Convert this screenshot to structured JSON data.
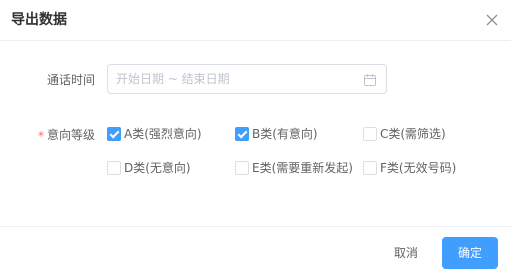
{
  "dialog": {
    "title": "导出数据",
    "close_icon": "close-icon"
  },
  "form": {
    "date_label": "通话时间",
    "date_placeholder": "开始日期 ~ 结束日期",
    "date_icon": "calendar-icon",
    "level_required_mark": "*",
    "level_label": "意向等级",
    "levels": [
      {
        "label": "A类(强烈意向)",
        "checked": true
      },
      {
        "label": "B类(有意向)",
        "checked": true
      },
      {
        "label": "C类(需筛选)",
        "checked": false
      },
      {
        "label": "D类(无意向)",
        "checked": false
      },
      {
        "label": "E类(需要重新发起)",
        "checked": false
      },
      {
        "label": "F类(无效号码)",
        "checked": false
      }
    ]
  },
  "footer": {
    "cancel_label": "取消",
    "confirm_label": "确定"
  },
  "colors": {
    "primary": "#409eff",
    "required": "#f56c6c",
    "border": "#dcdfe6",
    "placeholder": "#c0c4cc"
  }
}
